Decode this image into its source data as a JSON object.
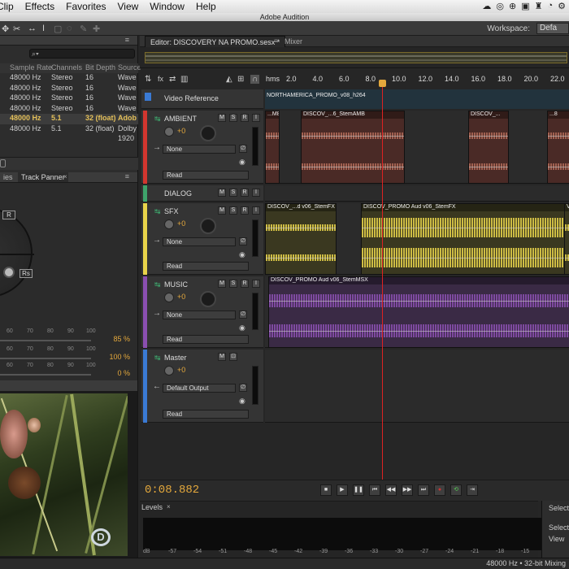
{
  "menubar": {
    "items": [
      "Clip",
      "Effects",
      "Favorites",
      "View",
      "Window",
      "Help"
    ],
    "app_title": "Adobe Audition"
  },
  "toolbar": {
    "workspace_label": "Workspace:",
    "workspace_value": "Defa"
  },
  "files": {
    "search_placeholder": "",
    "columns": [
      "Sample Rate",
      "Channels",
      "Bit Depth",
      "Source"
    ],
    "rows": [
      {
        "rate": "48000 Hz",
        "channels": "Stereo",
        "depth": "16",
        "source": "Wave"
      },
      {
        "rate": "48000 Hz",
        "channels": "Stereo",
        "depth": "16",
        "source": "Wave"
      },
      {
        "rate": "48000 Hz",
        "channels": "Stereo",
        "depth": "16",
        "source": "Wave"
      },
      {
        "rate": "48000 Hz",
        "channels": "Stereo",
        "depth": "16",
        "source": "Wave"
      },
      {
        "rate": "48000 Hz",
        "channels": "5.1",
        "depth": "32 (float)",
        "source": "Adob",
        "selected": true
      },
      {
        "rate": "48000 Hz",
        "channels": "5.1",
        "depth": "32 (float)",
        "source": "Dolby"
      },
      {
        "rate": "",
        "channels": "",
        "depth": "",
        "source": "1920"
      }
    ]
  },
  "panner": {
    "tabs": [
      "ies",
      "Track Panner"
    ],
    "labels": {
      "r": "R",
      "rs": "Rs"
    },
    "sliders": [
      {
        "ticks": [
          "60",
          "70",
          "80",
          "90",
          "100"
        ],
        "value": "85 %"
      },
      {
        "ticks": [
          "60",
          "70",
          "80",
          "90",
          "100"
        ],
        "value": "100 %"
      },
      {
        "ticks": [
          "60",
          "70",
          "80",
          "90",
          "100"
        ],
        "value": "0 %"
      }
    ]
  },
  "editor": {
    "tab_label": "Editor: DISCOVERY NA PROMO.sesx *",
    "mixer_tab": "Mixer",
    "ruler_unit": "hms",
    "ruler_ticks": [
      "2.0",
      "4.0",
      "6.0",
      "8.0",
      "10.0",
      "12.0",
      "14.0",
      "16.0",
      "18.0",
      "20.0",
      "22.0"
    ],
    "timecode": "0:08.882"
  },
  "tracks": [
    {
      "id": "video",
      "name": "Video Reference",
      "clip": "NORTHAMERICA_PROMO_v08_h264"
    },
    {
      "id": "ambient",
      "name": "AMBIENT",
      "vol": "+0",
      "input": "None",
      "mode": "Read",
      "color": "#d2362f",
      "clips": [
        "...M8",
        "DISCOV_...6_StemAMB",
        "DISCOV_...",
        "...8"
      ]
    },
    {
      "id": "dialog",
      "name": "DIALOG",
      "color": "#3ea36b"
    },
    {
      "id": "sfx",
      "name": "SFX",
      "vol": "+0",
      "input": "None",
      "mode": "Read",
      "color": "#e8d44a",
      "clips": [
        "DISCOV_...d v06_StemFX",
        "DISCOV_PROMO Aud v06_StemFX",
        "Vo"
      ]
    },
    {
      "id": "music",
      "name": "MUSIC",
      "vol": "+0",
      "input": "None",
      "mode": "Read",
      "color": "#8a4fb0",
      "clips": [
        "DISCOV_PROMO Aud v06_StemMSX"
      ]
    },
    {
      "id": "master",
      "name": "Master",
      "vol": "+0",
      "input": "Default Output",
      "mode": "Read",
      "color": "#3a7ad4"
    }
  ],
  "levels": {
    "tab": "Levels",
    "scale": [
      "dB",
      "-57",
      "-54",
      "-51",
      "-48",
      "-45",
      "-42",
      "-39",
      "-36",
      "-33",
      "-30",
      "-27",
      "-24",
      "-21",
      "-18",
      "-15",
      "-12"
    ]
  },
  "selection_panel": {
    "title": "Selectio",
    "rows": [
      "Selectio",
      "View"
    ]
  },
  "status": {
    "text": "48000 Hz • 32-bit Mixing"
  }
}
